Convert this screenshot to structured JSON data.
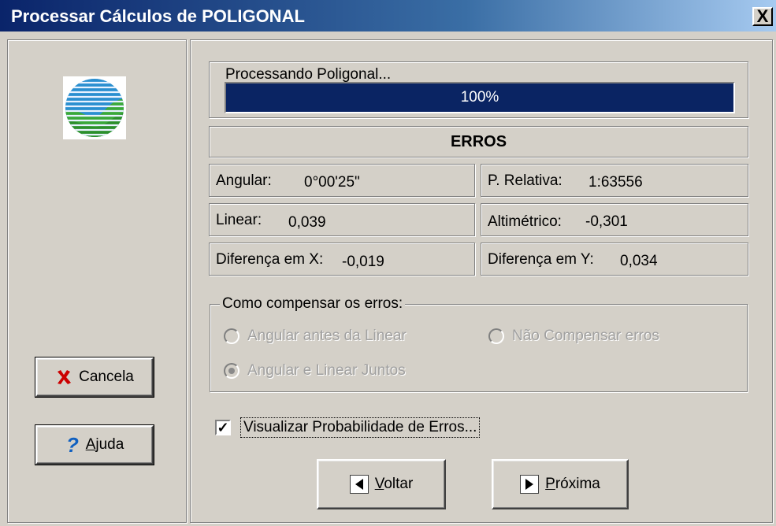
{
  "window": {
    "title": "Processar Cálculos de POLIGONAL",
    "close_label": "X"
  },
  "sidebar": {
    "cancel_label": "Cancela",
    "help_label": "Ajuda"
  },
  "progress": {
    "label": "Processando Poligonal...",
    "percent_text": "100%",
    "value": 100
  },
  "errors": {
    "title": "ERROS",
    "angular_label": "Angular:",
    "angular_value": "0°00'25\"",
    "relative_label": "P. Relativa:",
    "relative_value": "1:63556",
    "linear_label": "Linear:",
    "linear_value": "0,039",
    "altimetric_label": "Altimétrico:",
    "altimetric_value": "-0,301",
    "dx_label": "Diferença em X:",
    "dx_value": "-0,019",
    "dy_label": "Diferença em Y:",
    "dy_value": "0,034"
  },
  "compensation": {
    "caption": "Como compensar os erros:",
    "option_angular_before": "Angular antes da Linear",
    "option_none": "Não Compensar erros",
    "option_together": "Angular e Linear Juntos",
    "selected": "Angular e Linear Juntos"
  },
  "visualize": {
    "label": "Visualizar Probabilidade de Erros...",
    "checked": true
  },
  "nav": {
    "back_label": "Voltar",
    "next_label": "Próxima"
  },
  "colors": {
    "title_start": "#0a246a",
    "progress_fill": "#0a2463",
    "cancel_icon": "#cc0000",
    "help_icon": "#1060c0"
  }
}
